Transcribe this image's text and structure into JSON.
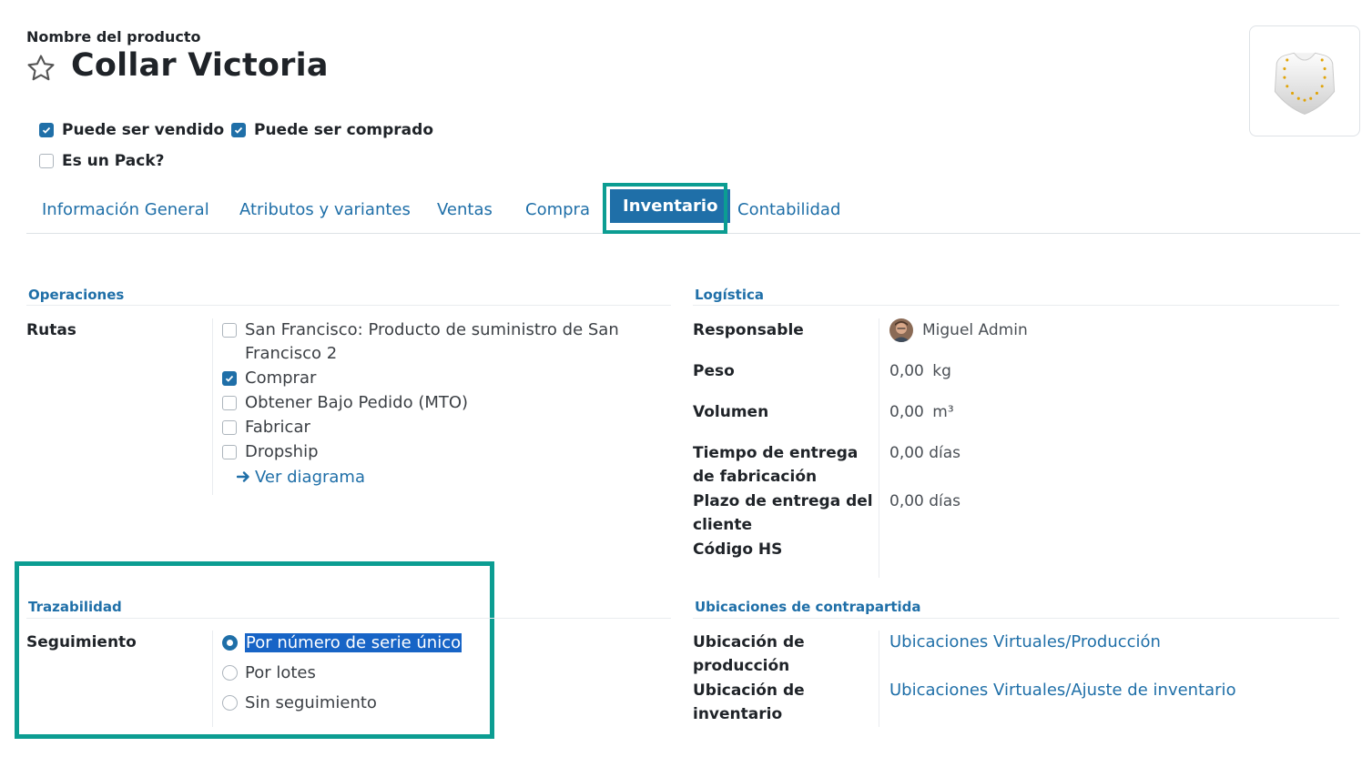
{
  "header": {
    "product_label": "Nombre del producto",
    "product_name": "Collar Victoria"
  },
  "flags": {
    "can_be_sold": "Puede ser vendido",
    "can_be_purchased": "Puede ser comprado",
    "is_pack": "Es un Pack?"
  },
  "tabs": [
    {
      "label": "Información General"
    },
    {
      "label": "Atributos y variantes"
    },
    {
      "label": "Ventas"
    },
    {
      "label": "Compra"
    },
    {
      "label": "Inventario"
    },
    {
      "label": "Contabilidad"
    }
  ],
  "operations": {
    "title": "Operaciones",
    "routes_label": "Rutas",
    "routes": [
      {
        "label": "San Francisco: Producto de suministro de San Francisco 2",
        "checked": false
      },
      {
        "label": "Comprar",
        "checked": true
      },
      {
        "label": "Obtener Bajo Pedido (MTO)",
        "checked": false
      },
      {
        "label": "Fabricar",
        "checked": false
      },
      {
        "label": "Dropship",
        "checked": false
      }
    ],
    "diagram_link": "Ver diagrama"
  },
  "logistics": {
    "title": "Logística",
    "responsible_label": "Responsable",
    "responsible_value": "Miguel Admin",
    "weight_label": "Peso",
    "weight_value": "0,00",
    "weight_unit": "kg",
    "volume_label": "Volumen",
    "volume_value": "0,00",
    "volume_unit": "m³",
    "mfg_lead_label_1": "Tiempo de entrega",
    "mfg_lead_label_2": "de fabricación",
    "mfg_lead_value": "0,00 días",
    "customer_lead_label_1": "Plazo de entrega del",
    "customer_lead_label_2": "cliente",
    "customer_lead_value": "0,00 días",
    "hs_code_label": "Código HS"
  },
  "traceability": {
    "title": "Trazabilidad",
    "tracking_label": "Seguimiento",
    "options": [
      {
        "label": "Por número de serie único",
        "selected": true
      },
      {
        "label": "Por lotes",
        "selected": false
      },
      {
        "label": "Sin seguimiento",
        "selected": false
      }
    ]
  },
  "counterpart": {
    "title": "Ubicaciones de contrapartida",
    "production_label_1": "Ubicación de",
    "production_label_2": "producción",
    "production_value": "Ubicaciones Virtuales/Producción",
    "inventory_label_1": "Ubicación de",
    "inventory_label_2": "inventario",
    "inventory_value": "Ubicaciones Virtuales/Ajuste de inventario"
  },
  "colors": {
    "accent": "#1f6fa8",
    "highlight_frame": "#0c9d92",
    "selection": "#1764c6"
  }
}
